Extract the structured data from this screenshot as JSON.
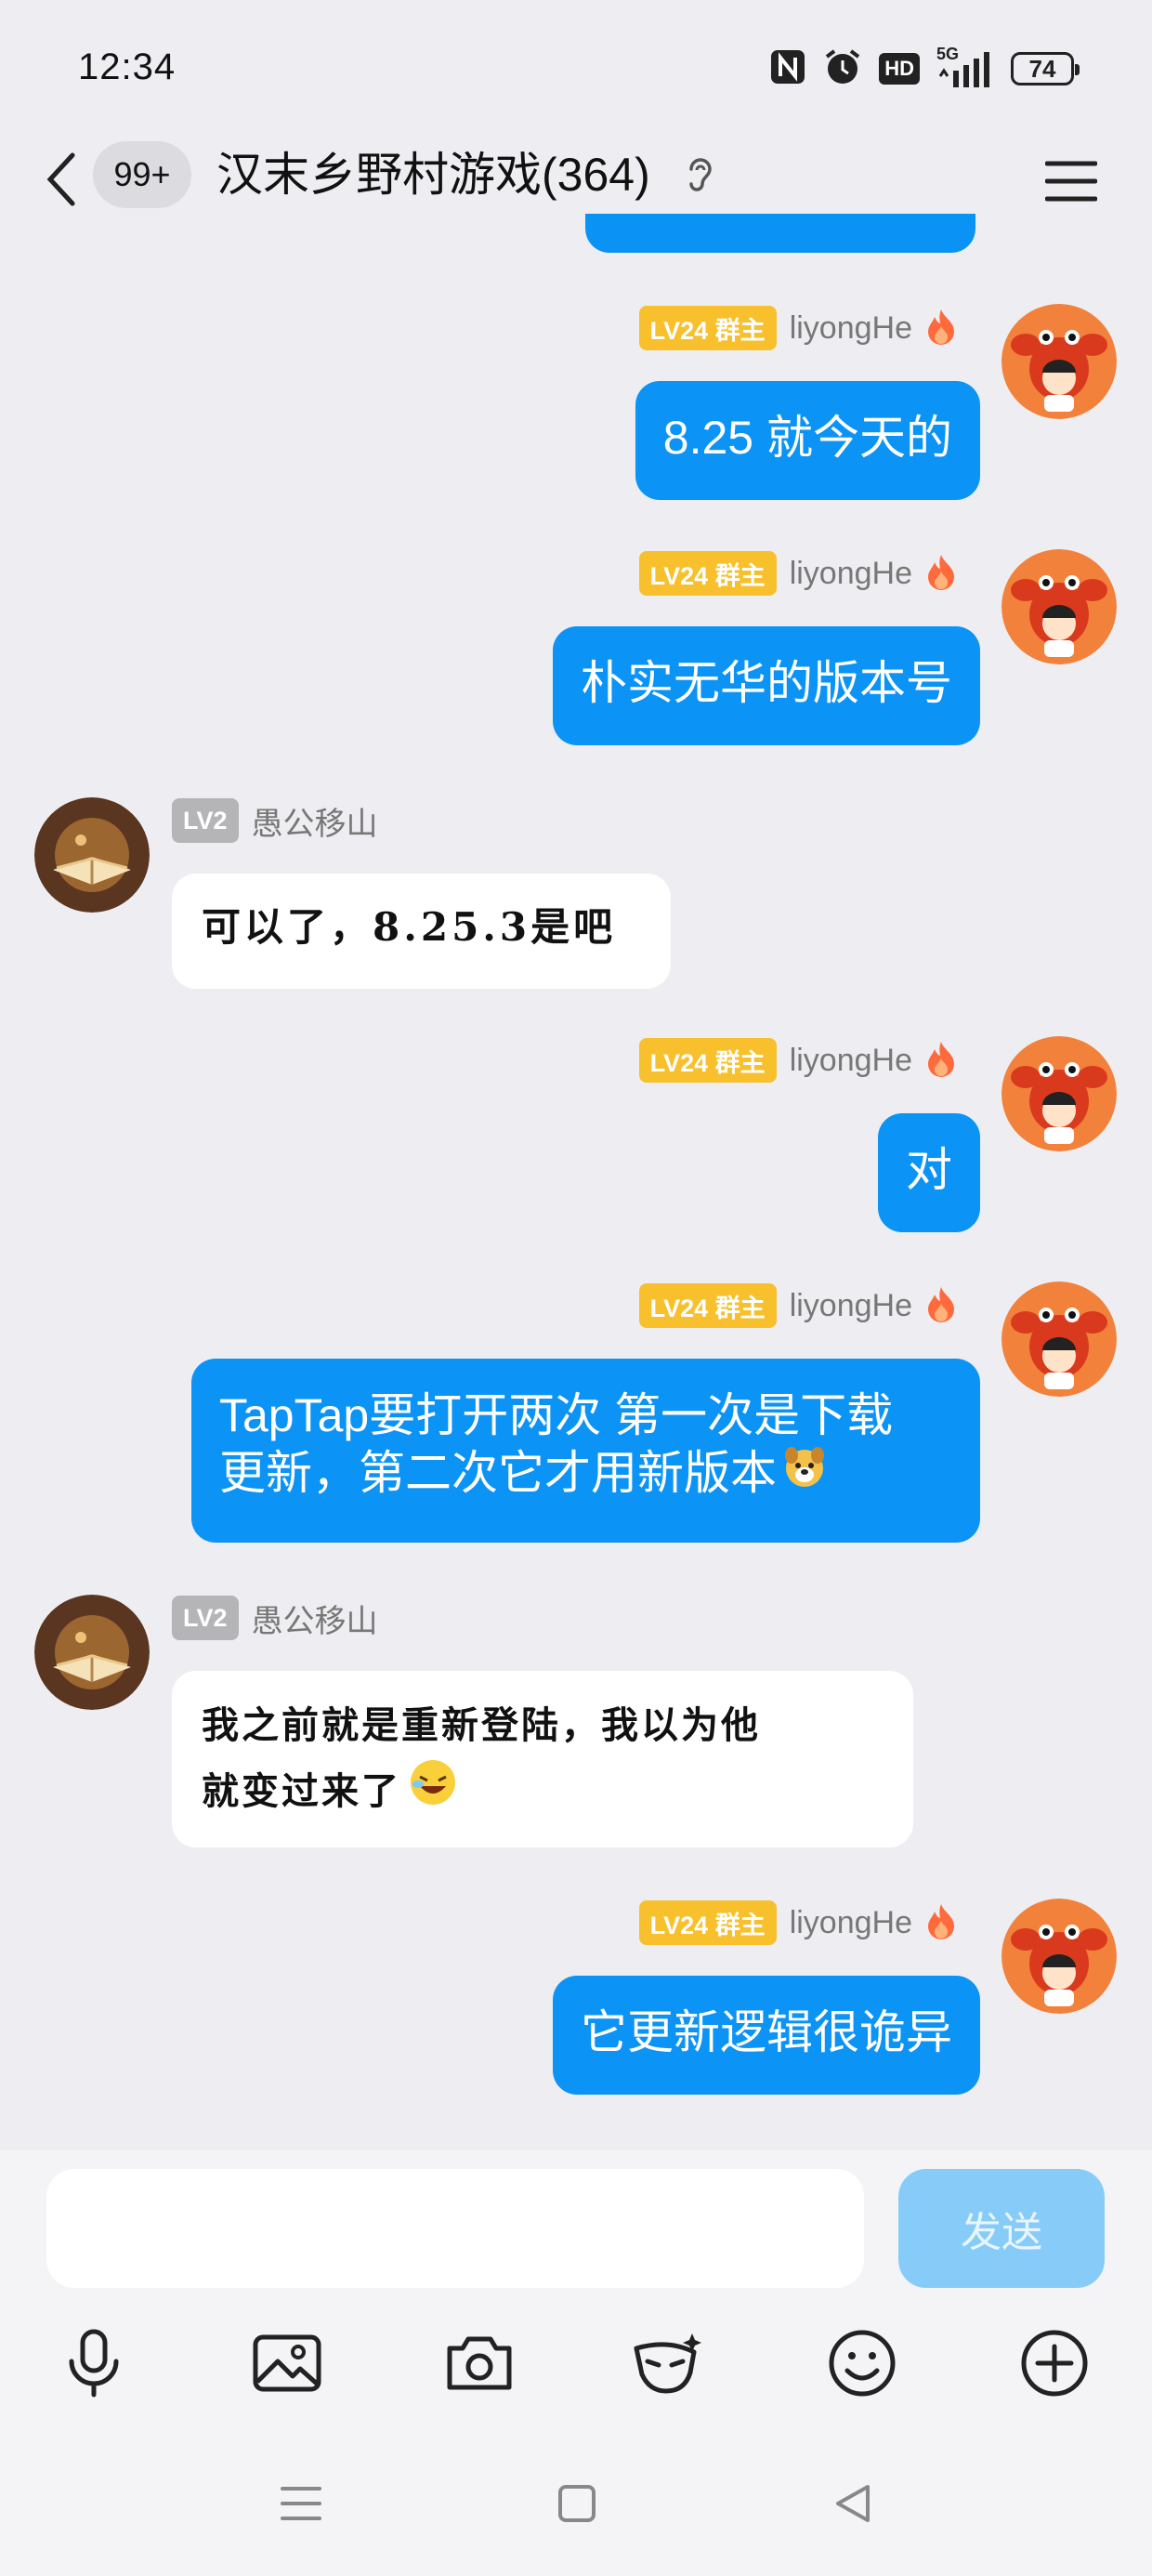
{
  "status_bar": {
    "time": "12:34",
    "icons": [
      "nfc-icon",
      "alarm-icon",
      "hd-icon",
      "signal-5g-icon"
    ],
    "network_label": "5G",
    "hd_label": "HD",
    "battery": "74"
  },
  "header": {
    "unread_badge": "99+",
    "title": "汉末乡野村游戏(364)",
    "icons": [
      "back-chevron-icon",
      "ear-icon",
      "menu-icon"
    ]
  },
  "messages": [
    {
      "side": "out",
      "level": "LV24 群主",
      "name": "liyongHe",
      "text": "8.25 就今天的"
    },
    {
      "side": "out",
      "level": "LV24 群主",
      "name": "liyongHe",
      "text": "朴实无华的版本号"
    },
    {
      "side": "in",
      "level": "LV2",
      "name": "愚公移山",
      "text": "可以了，8.25.3是吧"
    },
    {
      "side": "out",
      "level": "LV24 群主",
      "name": "liyongHe",
      "text": "对"
    },
    {
      "side": "out",
      "level": "LV24 群主",
      "name": "liyongHe",
      "text_line1": "TapTap要打开两次 第一次是下载",
      "text_line2": "更新，第二次它才用新版本"
    },
    {
      "side": "in",
      "level": "LV2",
      "name": "愚公移山",
      "text_line1": "我之前就是重新登陆，我以为他",
      "text_line2": "就变过来了"
    },
    {
      "side": "out",
      "level": "LV24 群主",
      "name": "liyongHe",
      "text": "它更新逻辑很诡异"
    }
  ],
  "input": {
    "placeholder": "",
    "send_label": "发送",
    "toolbar_icons": [
      "microphone-icon",
      "image-icon",
      "camera-icon",
      "mask-icon",
      "emoji-icon",
      "plus-icon"
    ]
  },
  "nav_bar": {
    "icons": [
      "menu-lines-icon",
      "home-square-icon",
      "back-triangle-icon"
    ]
  },
  "colors": {
    "background": "#eeeef2",
    "bubble_out": "#0b93f6",
    "bubble_in": "#ffffff",
    "level_owner": "#f7c02c",
    "level_member": "#b5b5b8",
    "send_disabled": "#87ccf9"
  }
}
